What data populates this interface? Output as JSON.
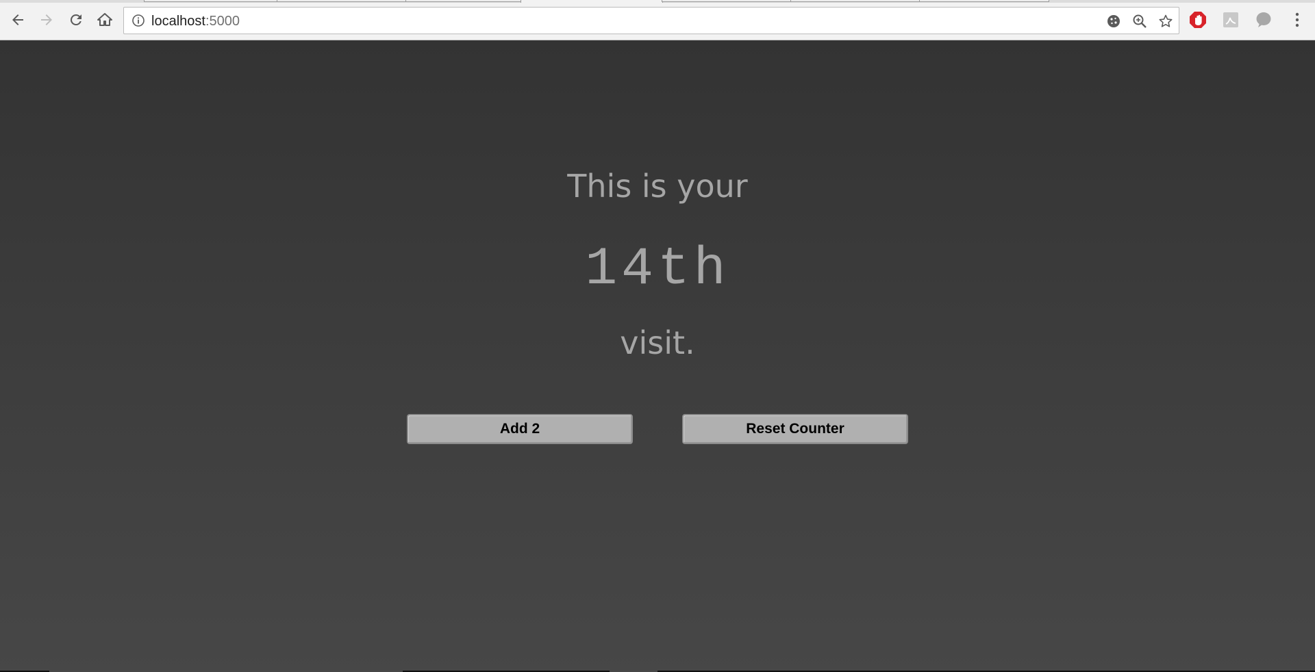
{
  "browser": {
    "url_host": "localhost",
    "url_port": ":5000",
    "icons": {
      "back": "arrow-left-icon",
      "forward": "arrow-right-icon",
      "reload": "reload-icon",
      "home": "home-icon",
      "site_info": "info-icon",
      "cookies": "cookie-icon",
      "zoom": "zoom-in-icon",
      "bookmark": "star-icon",
      "ext1": "adblock-icon",
      "ext2": "pdf-icon",
      "ext3": "chat-bubble-icon",
      "menu": "kebab-menu-icon"
    }
  },
  "page": {
    "intro": "This is your",
    "ordinal": "14th",
    "suffix": "visit.",
    "buttons": {
      "add_label": "Add 2",
      "reset_label": "Reset Counter"
    }
  },
  "colors": {
    "page_top": "#333333",
    "page_bottom": "#474747",
    "text": "#a6a6a6",
    "button_bg": "#b0b0b0"
  }
}
